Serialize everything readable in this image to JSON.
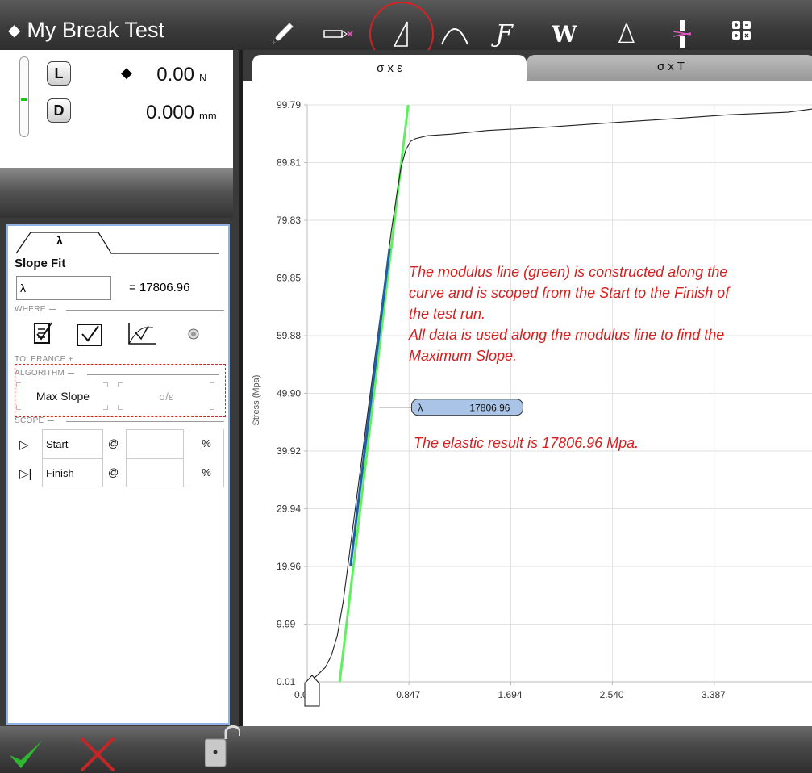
{
  "app": {
    "title": "My Break Test"
  },
  "toolbar": {
    "tools": [
      "pen-icon",
      "extensometer-icon",
      "slope-icon",
      "peak-icon",
      "yield-icon",
      "work-icon",
      "delta-icon",
      "break-icon",
      "calculator-icon"
    ],
    "tool_glyphs": {
      "yield": "Ƒ",
      "work": "W",
      "delta": "Δ"
    },
    "highlighted_tool": "slope-icon"
  },
  "readout": {
    "load_key": "L",
    "load_value": "0.00",
    "load_unit": "N",
    "disp_key": "D",
    "disp_value": "0.000",
    "disp_unit": "mm"
  },
  "form": {
    "tab_label": "λ",
    "heading": "Slope Fit",
    "lambda_input": "λ",
    "slope_result": "= 17806.96",
    "where_label": "WHERE",
    "tolerance_label": "TOLERANCE",
    "algorithm_label": "ALGORITHM",
    "algo_max_slope": "Max Slope",
    "algo_sigma_eps": "σ/ε",
    "scope_label": "SCOPE",
    "start_label": "Start",
    "finish_label": "Finish",
    "at_symbol": "@",
    "start_value": "",
    "finish_value": "",
    "percent": "%"
  },
  "tabs": {
    "active": "σ x ε",
    "other": "σ x T"
  },
  "colors": {
    "accent_red": "#d62222",
    "green": "#2fb52f",
    "modulus_line": "#5ef05e",
    "fit_segment": "#1f5fa8"
  },
  "annotations": {
    "modulus_note": [
      "The modulus line (green) is constructed along the",
      "curve and is scoped from the Start to the Finish of",
      "the test run.",
      "All data is used along the modulus line to find the",
      "Maximum Slope."
    ],
    "result_note": "The elastic result is 17806.96 Mpa.",
    "marker_symbol": "λ",
    "marker_value": "17806.96"
  },
  "chart_data": {
    "type": "line",
    "ylabel": "Stress (Mpa)",
    "xlabel": "",
    "x_ticks": [
      "0.000",
      "0.847",
      "1.694",
      "2.540",
      "3.387"
    ],
    "y_ticks": [
      "0.01",
      "9.99",
      "19.96",
      "29.94",
      "39.92",
      "49.90",
      "59.88",
      "69.85",
      "79.83",
      "89.81",
      "99.79"
    ],
    "xlim": [
      0,
      4.2
    ],
    "ylim": [
      0.01,
      99.79
    ],
    "grid": true,
    "series": [
      {
        "x": [
          0,
          0.05,
          0.1,
          0.15,
          0.2,
          0.25,
          0.3,
          0.35,
          0.4,
          0.45,
          0.5,
          0.55,
          0.6,
          0.65,
          0.7,
          0.75,
          0.78,
          0.82,
          0.86,
          0.9,
          1.0,
          1.2,
          1.5,
          2.0,
          2.5,
          3.0,
          3.5,
          4.0,
          4.2
        ],
        "y": [
          0.01,
          0.5,
          1.5,
          2.5,
          4.5,
          8,
          14,
          22,
          30,
          38,
          46,
          54,
          62,
          70,
          78,
          85,
          89,
          92,
          93.5,
          94,
          94.4,
          94.8,
          95.3,
          96,
          96.6,
          97.4,
          98,
          98.6,
          99
        ]
      }
    ],
    "modulus_line": {
      "x": [
        0.27,
        0.84
      ],
      "y": [
        0.01,
        99.79
      ]
    },
    "fit_segment": {
      "x": [
        0.36,
        0.685
      ],
      "y": [
        20,
        75
      ]
    },
    "marker": {
      "x": 0.6,
      "y": 47.5
    }
  }
}
